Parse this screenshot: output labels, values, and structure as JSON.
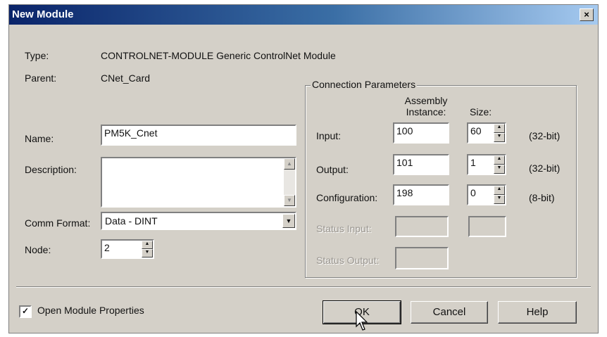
{
  "window": {
    "title": "New Module",
    "close_glyph": "×"
  },
  "info": {
    "type_label": "Type:",
    "type_value": "CONTROLNET-MODULE Generic ControlNet Module",
    "parent_label": "Parent:",
    "parent_value": "CNet_Card"
  },
  "form": {
    "name_label": "Name:",
    "name_value": "PM5K_Cnet",
    "description_label": "Description:",
    "description_value": "",
    "comm_format_label": "Comm Format:",
    "comm_format_value": "Data - DINT",
    "node_label": "Node:",
    "node_value": "2"
  },
  "connection": {
    "group_title": "Connection Parameters",
    "assembly_header_line1": "Assembly",
    "assembly_header_line2": "Instance:",
    "size_header": "Size:",
    "rows": [
      {
        "label": "Input:",
        "instance": "100",
        "size": "60",
        "unit": "(32-bit)",
        "enabled": true
      },
      {
        "label": "Output:",
        "instance": "101",
        "size": "1",
        "unit": "(32-bit)",
        "enabled": true
      },
      {
        "label": "Configuration:",
        "instance": "198",
        "size": "0",
        "unit": "(8-bit)",
        "enabled": true
      },
      {
        "label": "Status Input:",
        "instance": "",
        "size": "",
        "unit": "",
        "enabled": false
      },
      {
        "label": "Status Output:",
        "instance": "",
        "size": "",
        "unit": "",
        "enabled": false
      }
    ]
  },
  "footer": {
    "open_props_label": "Open Module Properties",
    "open_props_checked": true,
    "ok_label": "OK",
    "cancel_label": "Cancel",
    "help_label": "Help"
  }
}
